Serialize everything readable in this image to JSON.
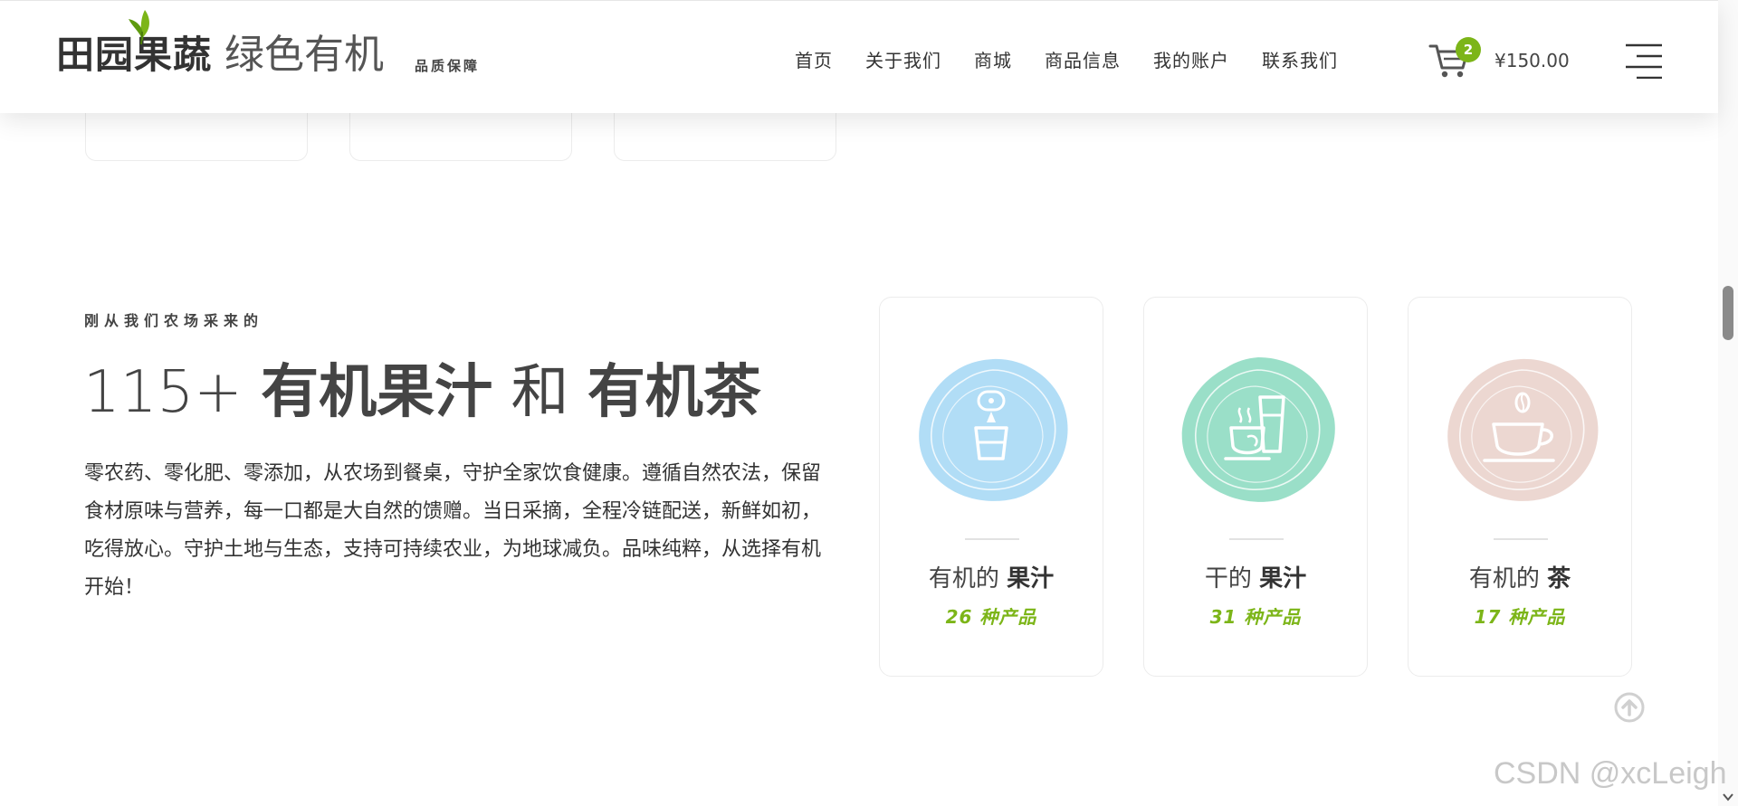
{
  "header": {
    "logo_bold": "田园果蔬",
    "logo_light": "绿色有机",
    "logo_tag": "品质保障",
    "nav": [
      "首页",
      "关于我们",
      "商城",
      "商品信息",
      "我的账户",
      "联系我们"
    ],
    "cart_count": "2",
    "cart_total": "¥150.00"
  },
  "intro": {
    "eyebrow": "刚从我们农场采来的",
    "headline_num": "115+",
    "headline_a": "有机果汁",
    "headline_and": "和",
    "headline_b": "有机茶",
    "description": "零农药、零化肥、零添加，从农场到餐桌，守护全家饮食健康。遵循自然农法，保留食材原味与营养，每一口都是大自然的馈赠。当日采摘，全程冷链配送，新鲜如初，吃得放心。守护土地与生态，支持可持续农业，为地球减负。品味纯粹，从选择有机开始！"
  },
  "categories": [
    {
      "title_prefix": "有机的",
      "title_bold": "果汁",
      "count": "26 种产品",
      "color": "#a9d9f5",
      "icon": "juice-glass-icon"
    },
    {
      "title_prefix": "干的",
      "title_bold": "果汁",
      "count": "31 种产品",
      "color": "#8fdcc2",
      "icon": "tea-and-juice-icon"
    },
    {
      "title_prefix": "有机的",
      "title_bold": "茶",
      "count": "17 种产品",
      "color": "#ead3cc",
      "icon": "coffee-cup-icon"
    }
  ],
  "colors": {
    "accent": "#7cb518",
    "text": "#333333"
  },
  "watermark": "CSDN @xcLeigh"
}
